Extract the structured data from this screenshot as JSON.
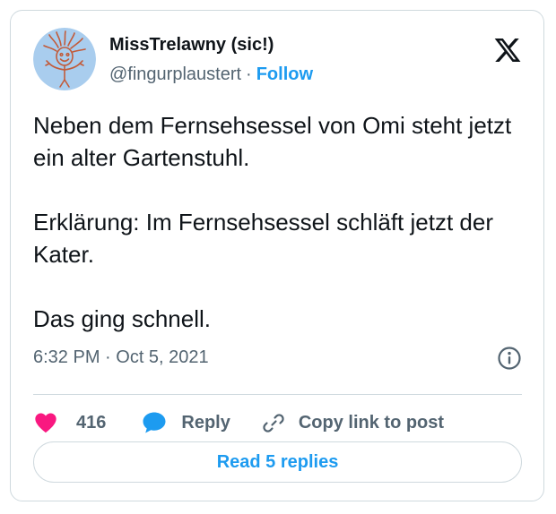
{
  "author": {
    "display_name": "MissTrelawny (sic!)",
    "handle": "@fingurplaustert",
    "separator": "·",
    "follow_label": "Follow"
  },
  "tweet": {
    "paragraphs": [
      "Neben dem Fernsehsessel von Omi steht jetzt ein alter Gartenstuhl.",
      "Erklärung: Im Fernsehsessel schläft jetzt der Kater.",
      "Das ging schnell."
    ],
    "timestamp": "6:32 PM · Oct 5, 2021"
  },
  "actions": {
    "like_count": "416",
    "reply_label": "Reply",
    "copy_link_label": "Copy link to post"
  },
  "read_replies_label": "Read 5 replies",
  "icons": {
    "logo": "x-logo-icon",
    "info": "info-icon",
    "like": "heart-icon",
    "reply": "speech-bubble-icon",
    "copy": "link-icon"
  },
  "colors": {
    "accent": "#1d9bf0",
    "like": "#f91880",
    "secondary_text": "#536471",
    "border": "#cfd9de",
    "avatar_bg": "#a9cdee",
    "avatar_drawing": "#c25b3a"
  }
}
